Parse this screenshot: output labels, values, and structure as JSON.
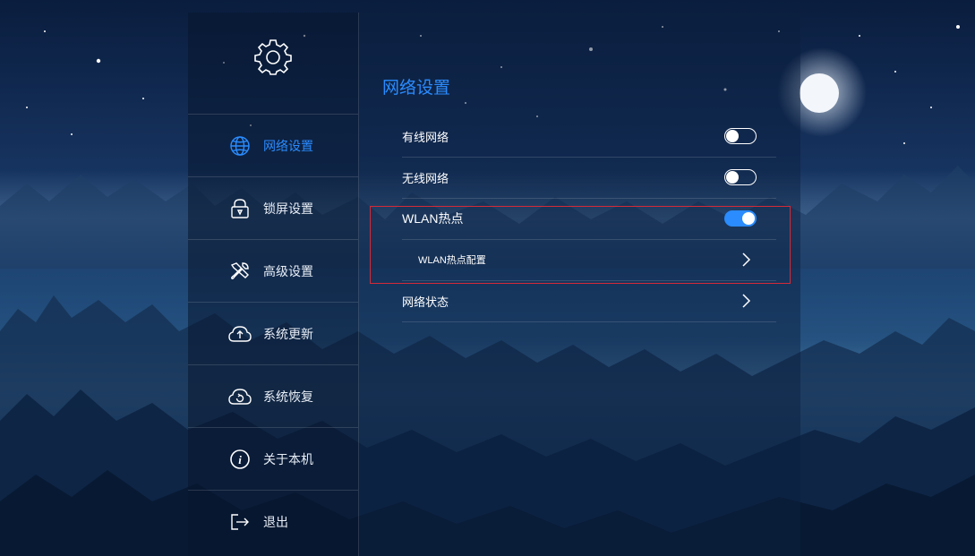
{
  "colors": {
    "accent": "#2a8cff",
    "highlight_box": "#d42a38",
    "text": "#ffffff"
  },
  "settings_icon": "gear-icon",
  "sidebar": {
    "items": [
      {
        "label": "网络设置",
        "icon": "globe-icon",
        "active": true
      },
      {
        "label": "锁屏设置",
        "icon": "lock-icon",
        "active": false
      },
      {
        "label": "高级设置",
        "icon": "tools-icon",
        "active": false
      },
      {
        "label": "系统更新",
        "icon": "cloud-upload-icon",
        "active": false
      },
      {
        "label": "系统恢复",
        "icon": "cloud-restore-icon",
        "active": false
      },
      {
        "label": "关于本机",
        "icon": "info-icon",
        "active": false
      },
      {
        "label": "退出",
        "icon": "exit-icon",
        "active": false
      }
    ]
  },
  "main": {
    "title": "网络设置",
    "rows": [
      {
        "label": "有线网络",
        "control": "toggle",
        "on": false
      },
      {
        "label": "无线网络",
        "control": "toggle",
        "on": false
      },
      {
        "label": "WLAN热点",
        "control": "toggle",
        "on": true
      },
      {
        "label": "WLAN热点配置",
        "control": "chevron"
      },
      {
        "label": "网络状态",
        "control": "chevron"
      }
    ]
  }
}
